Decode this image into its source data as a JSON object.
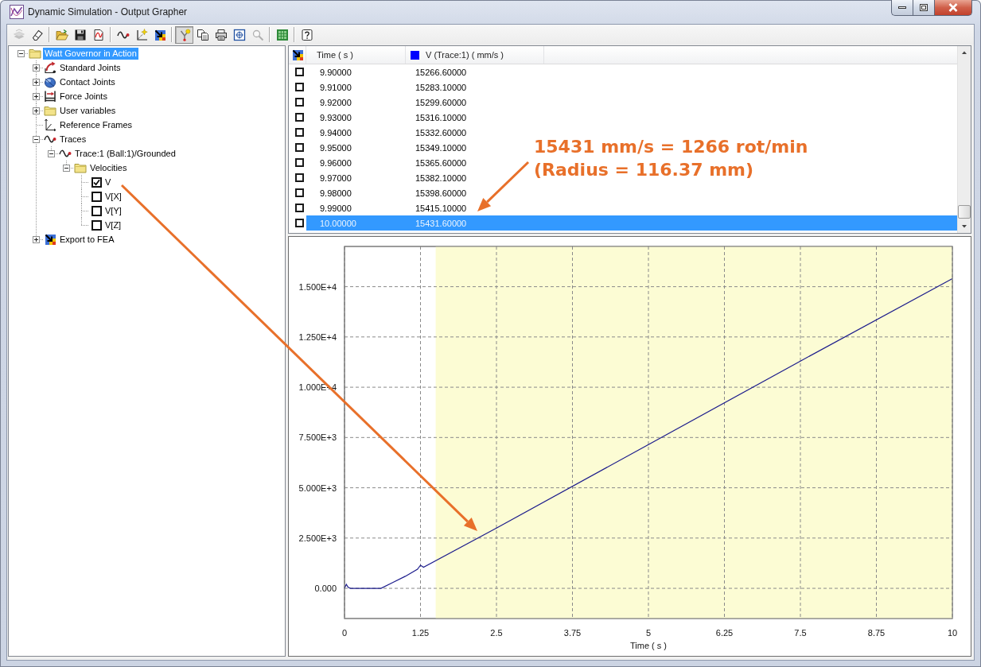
{
  "window": {
    "title": "Dynamic Simulation - Output Grapher"
  },
  "toolbar": [
    [
      {
        "kind": "layers",
        "disabled": true,
        "pressed": false
      },
      {
        "kind": "eraser",
        "disabled": false,
        "pressed": false
      }
    ],
    [
      {
        "kind": "open",
        "disabled": false,
        "pressed": false
      },
      {
        "kind": "save",
        "disabled": false,
        "pressed": false
      },
      {
        "kind": "page-curve",
        "disabled": false,
        "pressed": false
      }
    ],
    [
      {
        "kind": "wave",
        "disabled": false,
        "pressed": false
      },
      {
        "kind": "axes-star",
        "disabled": false,
        "pressed": false
      },
      {
        "kind": "export",
        "disabled": false,
        "pressed": false
      }
    ],
    [
      {
        "kind": "probe",
        "disabled": false,
        "pressed": true
      },
      {
        "kind": "copy",
        "disabled": false,
        "pressed": false
      },
      {
        "kind": "print",
        "disabled": false,
        "pressed": false
      },
      {
        "kind": "fit",
        "disabled": false,
        "pressed": false
      },
      {
        "kind": "zoom",
        "disabled": true,
        "pressed": false
      }
    ],
    [
      {
        "kind": "grid",
        "disabled": false,
        "pressed": false
      }
    ],
    [
      {
        "kind": "help",
        "disabled": false,
        "pressed": false
      }
    ]
  ],
  "tree": [
    {
      "label": "Watt Governor in Action",
      "kind": "folder",
      "expanded": true,
      "selected": true,
      "children": [
        {
          "label": "Standard Joints",
          "kind": "joint",
          "expanded": false,
          "selected": false
        },
        {
          "label": "Contact Joints",
          "kind": "contact",
          "expanded": false,
          "selected": false
        },
        {
          "label": "Force Joints",
          "kind": "force",
          "expanded": false,
          "selected": false
        },
        {
          "label": "User variables",
          "kind": "folder",
          "expanded": false,
          "selected": false
        },
        {
          "label": "Reference Frames",
          "kind": "frame",
          "selected": false
        },
        {
          "label": "Traces",
          "kind": "trace",
          "expanded": true,
          "selected": false,
          "children": [
            {
              "label": "Trace:1 (Ball:1)/Grounded",
              "kind": "trace",
              "expanded": true,
              "selected": false,
              "children": [
                {
                  "label": "Velocities",
                  "kind": "folder",
                  "expanded": true,
                  "selected": false,
                  "children": [
                    {
                      "label": "V",
                      "kind": "check",
                      "checked": true,
                      "selected": false
                    },
                    {
                      "label": "V[X]",
                      "kind": "check",
                      "checked": false,
                      "selected": false
                    },
                    {
                      "label": "V[Y]",
                      "kind": "check",
                      "checked": false,
                      "selected": false
                    },
                    {
                      "label": "V[Z]",
                      "kind": "check",
                      "checked": false,
                      "selected": false
                    }
                  ]
                }
              ]
            }
          ]
        },
        {
          "label": "Export to FEA",
          "kind": "export",
          "expanded": false,
          "selected": false
        }
      ]
    }
  ],
  "table": {
    "columns": [
      {
        "label": "Time ( s )"
      },
      {
        "label": "V (Trace:1) ( mm/s )",
        "color": "#0000ff"
      }
    ],
    "rows": [
      {
        "cells": [
          "9.90000",
          "15266.60000"
        ],
        "checked": false,
        "selected": false
      },
      {
        "cells": [
          "9.91000",
          "15283.10000"
        ],
        "checked": false,
        "selected": false
      },
      {
        "cells": [
          "9.92000",
          "15299.60000"
        ],
        "checked": false,
        "selected": false
      },
      {
        "cells": [
          "9.93000",
          "15316.10000"
        ],
        "checked": false,
        "selected": false
      },
      {
        "cells": [
          "9.94000",
          "15332.60000"
        ],
        "checked": false,
        "selected": false
      },
      {
        "cells": [
          "9.95000",
          "15349.10000"
        ],
        "checked": false,
        "selected": false
      },
      {
        "cells": [
          "9.96000",
          "15365.60000"
        ],
        "checked": false,
        "selected": false
      },
      {
        "cells": [
          "9.97000",
          "15382.10000"
        ],
        "checked": false,
        "selected": false
      },
      {
        "cells": [
          "9.98000",
          "15398.60000"
        ],
        "checked": false,
        "selected": false
      },
      {
        "cells": [
          "9.99000",
          "15415.10000"
        ],
        "checked": false,
        "selected": false
      },
      {
        "cells": [
          "10.00000",
          "15431.60000"
        ],
        "checked": false,
        "selected": true
      }
    ]
  },
  "graph": {
    "chart_data": {
      "type": "line",
      "xlabel": "Time ( s )",
      "x": [
        0,
        0.03,
        0.06,
        0.1,
        0.6,
        0.8,
        1,
        1.2,
        1.25,
        1.3,
        2.5,
        5,
        7.5,
        10
      ],
      "values": [
        0,
        200,
        50,
        0,
        0,
        300,
        600,
        950,
        1150,
        1050,
        3000,
        7150,
        11300,
        15400
      ],
      "color": "#1c1c8c",
      "xlim": [
        0,
        10
      ],
      "ylim": [
        -1500,
        17000
      ],
      "xticks": [
        0,
        1.25,
        2.5,
        3.75,
        5,
        6.25,
        7.5,
        8.75,
        10
      ],
      "yticks": [
        {
          "value": 0,
          "label": "0.000"
        },
        {
          "value": 2500,
          "label": "2.500E+3"
        },
        {
          "value": 5000,
          "label": "5.000E+3"
        },
        {
          "value": 7500,
          "label": "7.500E+3"
        },
        {
          "value": 10000,
          "label": "1.000E+4"
        },
        {
          "value": 12500,
          "label": "1.250E+4"
        },
        {
          "value": 15000,
          "label": "1.500E+4"
        }
      ],
      "grid": true,
      "bands": [
        {
          "axis": "x",
          "from": 1.5,
          "to": 10,
          "color": "#fcfcd4"
        }
      ]
    }
  },
  "callout": {
    "lines": [
      "15431 mm/s = 1266 rot/min",
      "(Radius = 116.37 mm)"
    ]
  }
}
